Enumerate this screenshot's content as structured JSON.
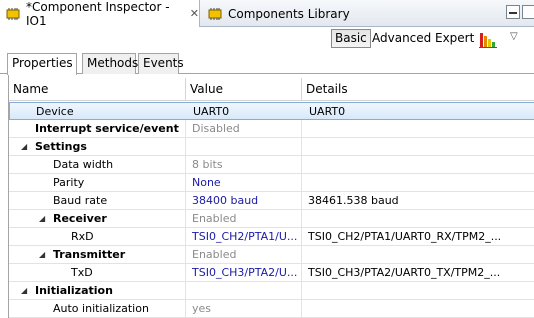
{
  "editor_tabs": {
    "active": {
      "label": "*Component Inspector - IO1",
      "close": "✕"
    },
    "inactive": {
      "label": "Components Library"
    }
  },
  "toolbar": {
    "levels": [
      "Basic",
      "Advanced",
      "Expert"
    ],
    "selected_level": "Basic",
    "view_menu": "▽"
  },
  "sub_tabs": [
    "Properties",
    "Methods",
    "Events"
  ],
  "table": {
    "columns": [
      "Name",
      "Value",
      "Details"
    ],
    "rows": [
      {
        "name": "Device",
        "value": "UART0",
        "details": "UART0",
        "indent": 0,
        "bold": false,
        "value_style": "normal",
        "expander": "",
        "selected": true
      },
      {
        "name": "Interrupt service/event",
        "value": "Disabled",
        "details": "",
        "indent": 0,
        "bold": true,
        "value_style": "gray",
        "expander": ""
      },
      {
        "name": "Settings",
        "value": "",
        "details": "",
        "indent": 0,
        "bold": true,
        "value_style": "normal",
        "expander": "◢"
      },
      {
        "name": "Data width",
        "value": "8 bits",
        "details": "",
        "indent": 1,
        "bold": false,
        "value_style": "gray",
        "expander": ""
      },
      {
        "name": "Parity",
        "value": "None",
        "details": "",
        "indent": 1,
        "bold": false,
        "value_style": "blue",
        "expander": ""
      },
      {
        "name": "Baud rate",
        "value": "38400 baud",
        "details": "38461.538 baud",
        "indent": 1,
        "bold": false,
        "value_style": "blue",
        "expander": ""
      },
      {
        "name": "Receiver",
        "value": "Enabled",
        "details": "",
        "indent": 1,
        "bold": true,
        "value_style": "gray",
        "expander": "◢"
      },
      {
        "name": "RxD",
        "value": "TSI0_CH2/PTA1/U...",
        "details": "TSI0_CH2/PTA1/UART0_RX/TPM2_...",
        "indent": 2,
        "bold": false,
        "value_style": "blue",
        "expander": ""
      },
      {
        "name": "Transmitter",
        "value": "Enabled",
        "details": "",
        "indent": 1,
        "bold": true,
        "value_style": "gray",
        "expander": "◢"
      },
      {
        "name": "TxD",
        "value": "TSI0_CH3/PTA2/U...",
        "details": "TSI0_CH3/PTA2/UART0_TX/TPM2_...",
        "indent": 2,
        "bold": false,
        "value_style": "blue",
        "expander": ""
      },
      {
        "name": "Initialization",
        "value": "",
        "details": "",
        "indent": 0,
        "bold": true,
        "value_style": "normal",
        "expander": "◢"
      },
      {
        "name": "Auto initialization",
        "value": "yes",
        "details": "",
        "indent": 1,
        "bold": false,
        "value_style": "gray",
        "expander": ""
      }
    ]
  },
  "icons": {
    "component": "component-chip-icon",
    "chart": "bar-chart-icon"
  },
  "colors": {
    "value_blue": "#1a1aa6",
    "value_gray": "#8a8a8a",
    "selection": "#d7e9fa"
  }
}
